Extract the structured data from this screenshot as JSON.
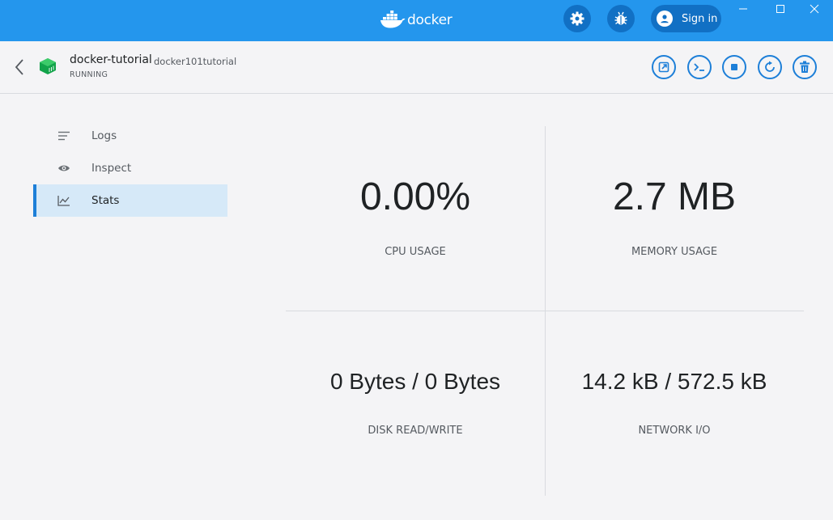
{
  "app": {
    "brand": "docker",
    "signin_label": "Sign in",
    "accent_color": "#2496ed"
  },
  "header": {
    "container_name": "docker-tutorial",
    "image_name": "docker101tutorial",
    "status": "RUNNING"
  },
  "sidebar": {
    "items": [
      {
        "label": "Logs",
        "icon": "lines-icon",
        "active": false
      },
      {
        "label": "Inspect",
        "icon": "eye-icon",
        "active": false
      },
      {
        "label": "Stats",
        "icon": "chart-line-icon",
        "active": true
      }
    ]
  },
  "stats": {
    "cpu": {
      "value": "0.00%",
      "label": "CPU USAGE"
    },
    "memory": {
      "value": "2.7 MB",
      "label": "MEMORY USAGE"
    },
    "disk": {
      "value": "0 Bytes / 0 Bytes",
      "label": "DISK READ/WRITE"
    },
    "network": {
      "value": "14.2 kB / 572.5 kB",
      "label": "NETWORK I/O"
    }
  }
}
